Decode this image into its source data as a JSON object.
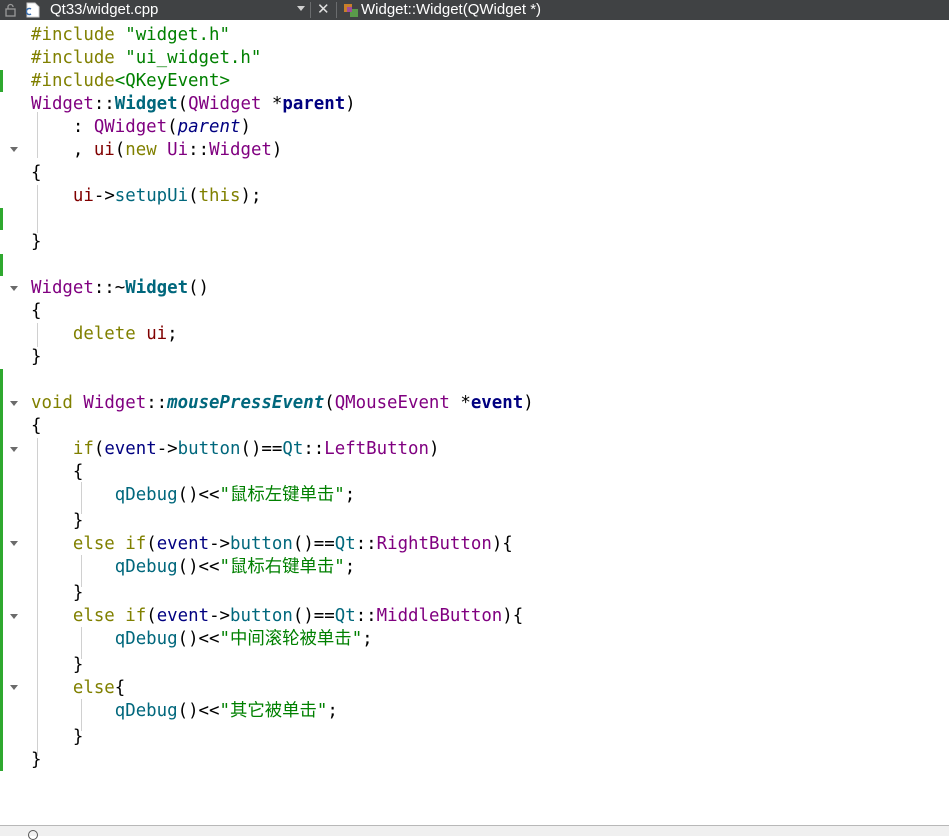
{
  "tab": {
    "file_name": "Qt33/widget.cpp",
    "symbol": "Widget::Widget(QWidget *)",
    "close_glyph": "✕"
  },
  "code": {
    "l1": [
      "#include ",
      "\"widget.h\""
    ],
    "l2": [
      "#include ",
      "\"ui_widget.h\""
    ],
    "l3": [
      "#include",
      "<QKeyEvent>"
    ],
    "l4": [
      "Widget",
      "::",
      "Widget",
      "(",
      "QWidget",
      " *",
      "parent",
      ")"
    ],
    "l5": [
      "    : ",
      "QWidget",
      "(",
      "parent",
      ")"
    ],
    "l6": [
      "    , ",
      "ui",
      "(",
      "new",
      " ",
      "Ui",
      "::",
      "Widget",
      ")"
    ],
    "l7": [
      "{"
    ],
    "l8": [
      "    ",
      "ui",
      "->",
      "setupUi",
      "(",
      "this",
      ");"
    ],
    "l10": [
      "}"
    ],
    "l12": [
      "Widget",
      "::~",
      "Widget",
      "()"
    ],
    "l13": [
      "{"
    ],
    "l14": [
      "    ",
      "delete",
      " ",
      "ui",
      ";"
    ],
    "l15": [
      "}"
    ],
    "l17": [
      "void",
      " ",
      "Widget",
      "::",
      "mousePressEvent",
      "(",
      "QMouseEvent",
      " *",
      "event",
      ")"
    ],
    "l18": [
      "{"
    ],
    "l19": [
      "    ",
      "if",
      "(",
      "event",
      "->",
      "button",
      "()==",
      "Qt",
      "::",
      "LeftButton",
      ")"
    ],
    "l20": [
      "    {"
    ],
    "l21": [
      "        ",
      "qDebug",
      "()<<",
      "\"鼠标左键单击\"",
      ";"
    ],
    "l22": [
      "    }"
    ],
    "l23": [
      "    ",
      "else",
      " ",
      "if",
      "(",
      "event",
      "->",
      "button",
      "()==",
      "Qt",
      "::",
      "RightButton",
      "){"
    ],
    "l24": [
      "        ",
      "qDebug",
      "()<<",
      "\"鼠标右键单击\"",
      ";"
    ],
    "l25": [
      "    }"
    ],
    "l26": [
      "    ",
      "else",
      " ",
      "if",
      "(",
      "event",
      "->",
      "button",
      "()==",
      "Qt",
      "::",
      "MiddleButton",
      "){"
    ],
    "l27": [
      "        ",
      "qDebug",
      "()<<",
      "\"中间滚轮被单击\"",
      ";"
    ],
    "l28": [
      "    }"
    ],
    "l29": [
      "    ",
      "else",
      "{"
    ],
    "l30": [
      "        ",
      "qDebug",
      "()<<",
      "\"其它被单击\"",
      ";"
    ],
    "l31": [
      "    }"
    ],
    "l32": [
      "}"
    ]
  },
  "colors": {
    "keyword": "#808000",
    "string": "#008000",
    "type": "#800080",
    "function": "#00677c",
    "member": "#800000",
    "parameter": "#000080",
    "gutter_change_mark": "#2fa82f",
    "tab_bar": "#404244"
  },
  "icons": [
    "lock-icon",
    "cpp-file-icon",
    "dropdown-arrow-icon",
    "close-icon",
    "class-symbol-icon",
    "fold-arrow-icon",
    "search-icon"
  ]
}
